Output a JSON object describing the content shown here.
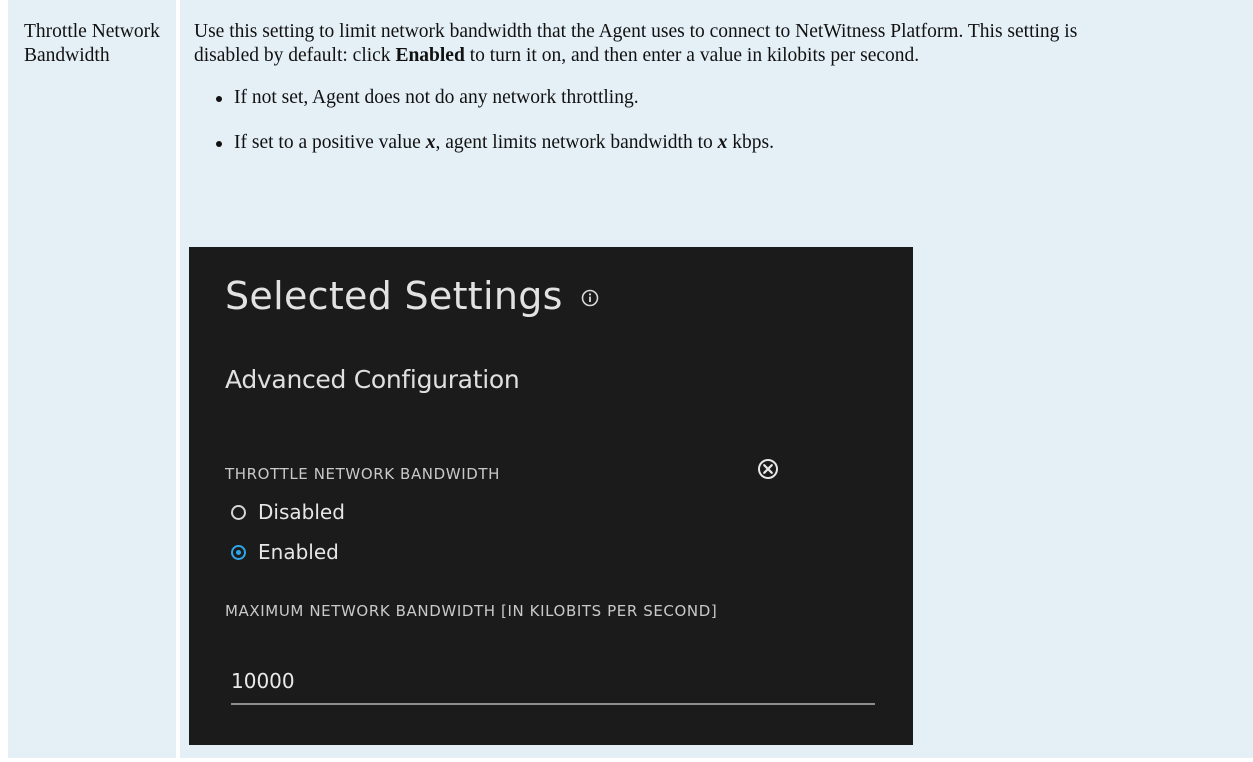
{
  "table": {
    "param_name": "Throttle Network Bandwidth",
    "description": {
      "part1": "Use this setting to limit network bandwidth that the Agent uses to connect to NetWitness Platform. This setting is disabled by default: click ",
      "bold": "Enabled",
      "part2": " to turn it on, and then enter a value in kilobits per second."
    },
    "bullets": {
      "b1": "If not set, Agent does not do any network throttling.",
      "b2_pre": "If set to a positive value ",
      "b2_var": "x",
      "b2_mid": ", agent limits network bandwidth to ",
      "b2_var2": "x",
      "b2_post": " kbps."
    }
  },
  "screenshot": {
    "title": "Selected Settings",
    "subtitle": "Advanced Configuration",
    "setting_label": "THROTTLE NETWORK BANDWIDTH",
    "options": [
      {
        "label": "Disabled",
        "selected": false
      },
      {
        "label": "Enabled",
        "selected": true
      }
    ],
    "max_label": "MAXIMUM NETWORK BANDWIDTH [IN KILOBITS PER SECOND]",
    "max_value": "10000",
    "icons": {
      "info": "info-icon",
      "clear": "clear-icon"
    },
    "colors": {
      "background": "#1b1b1b",
      "accent": "#2fa6e8",
      "cell_background": "#e4eff6"
    }
  }
}
